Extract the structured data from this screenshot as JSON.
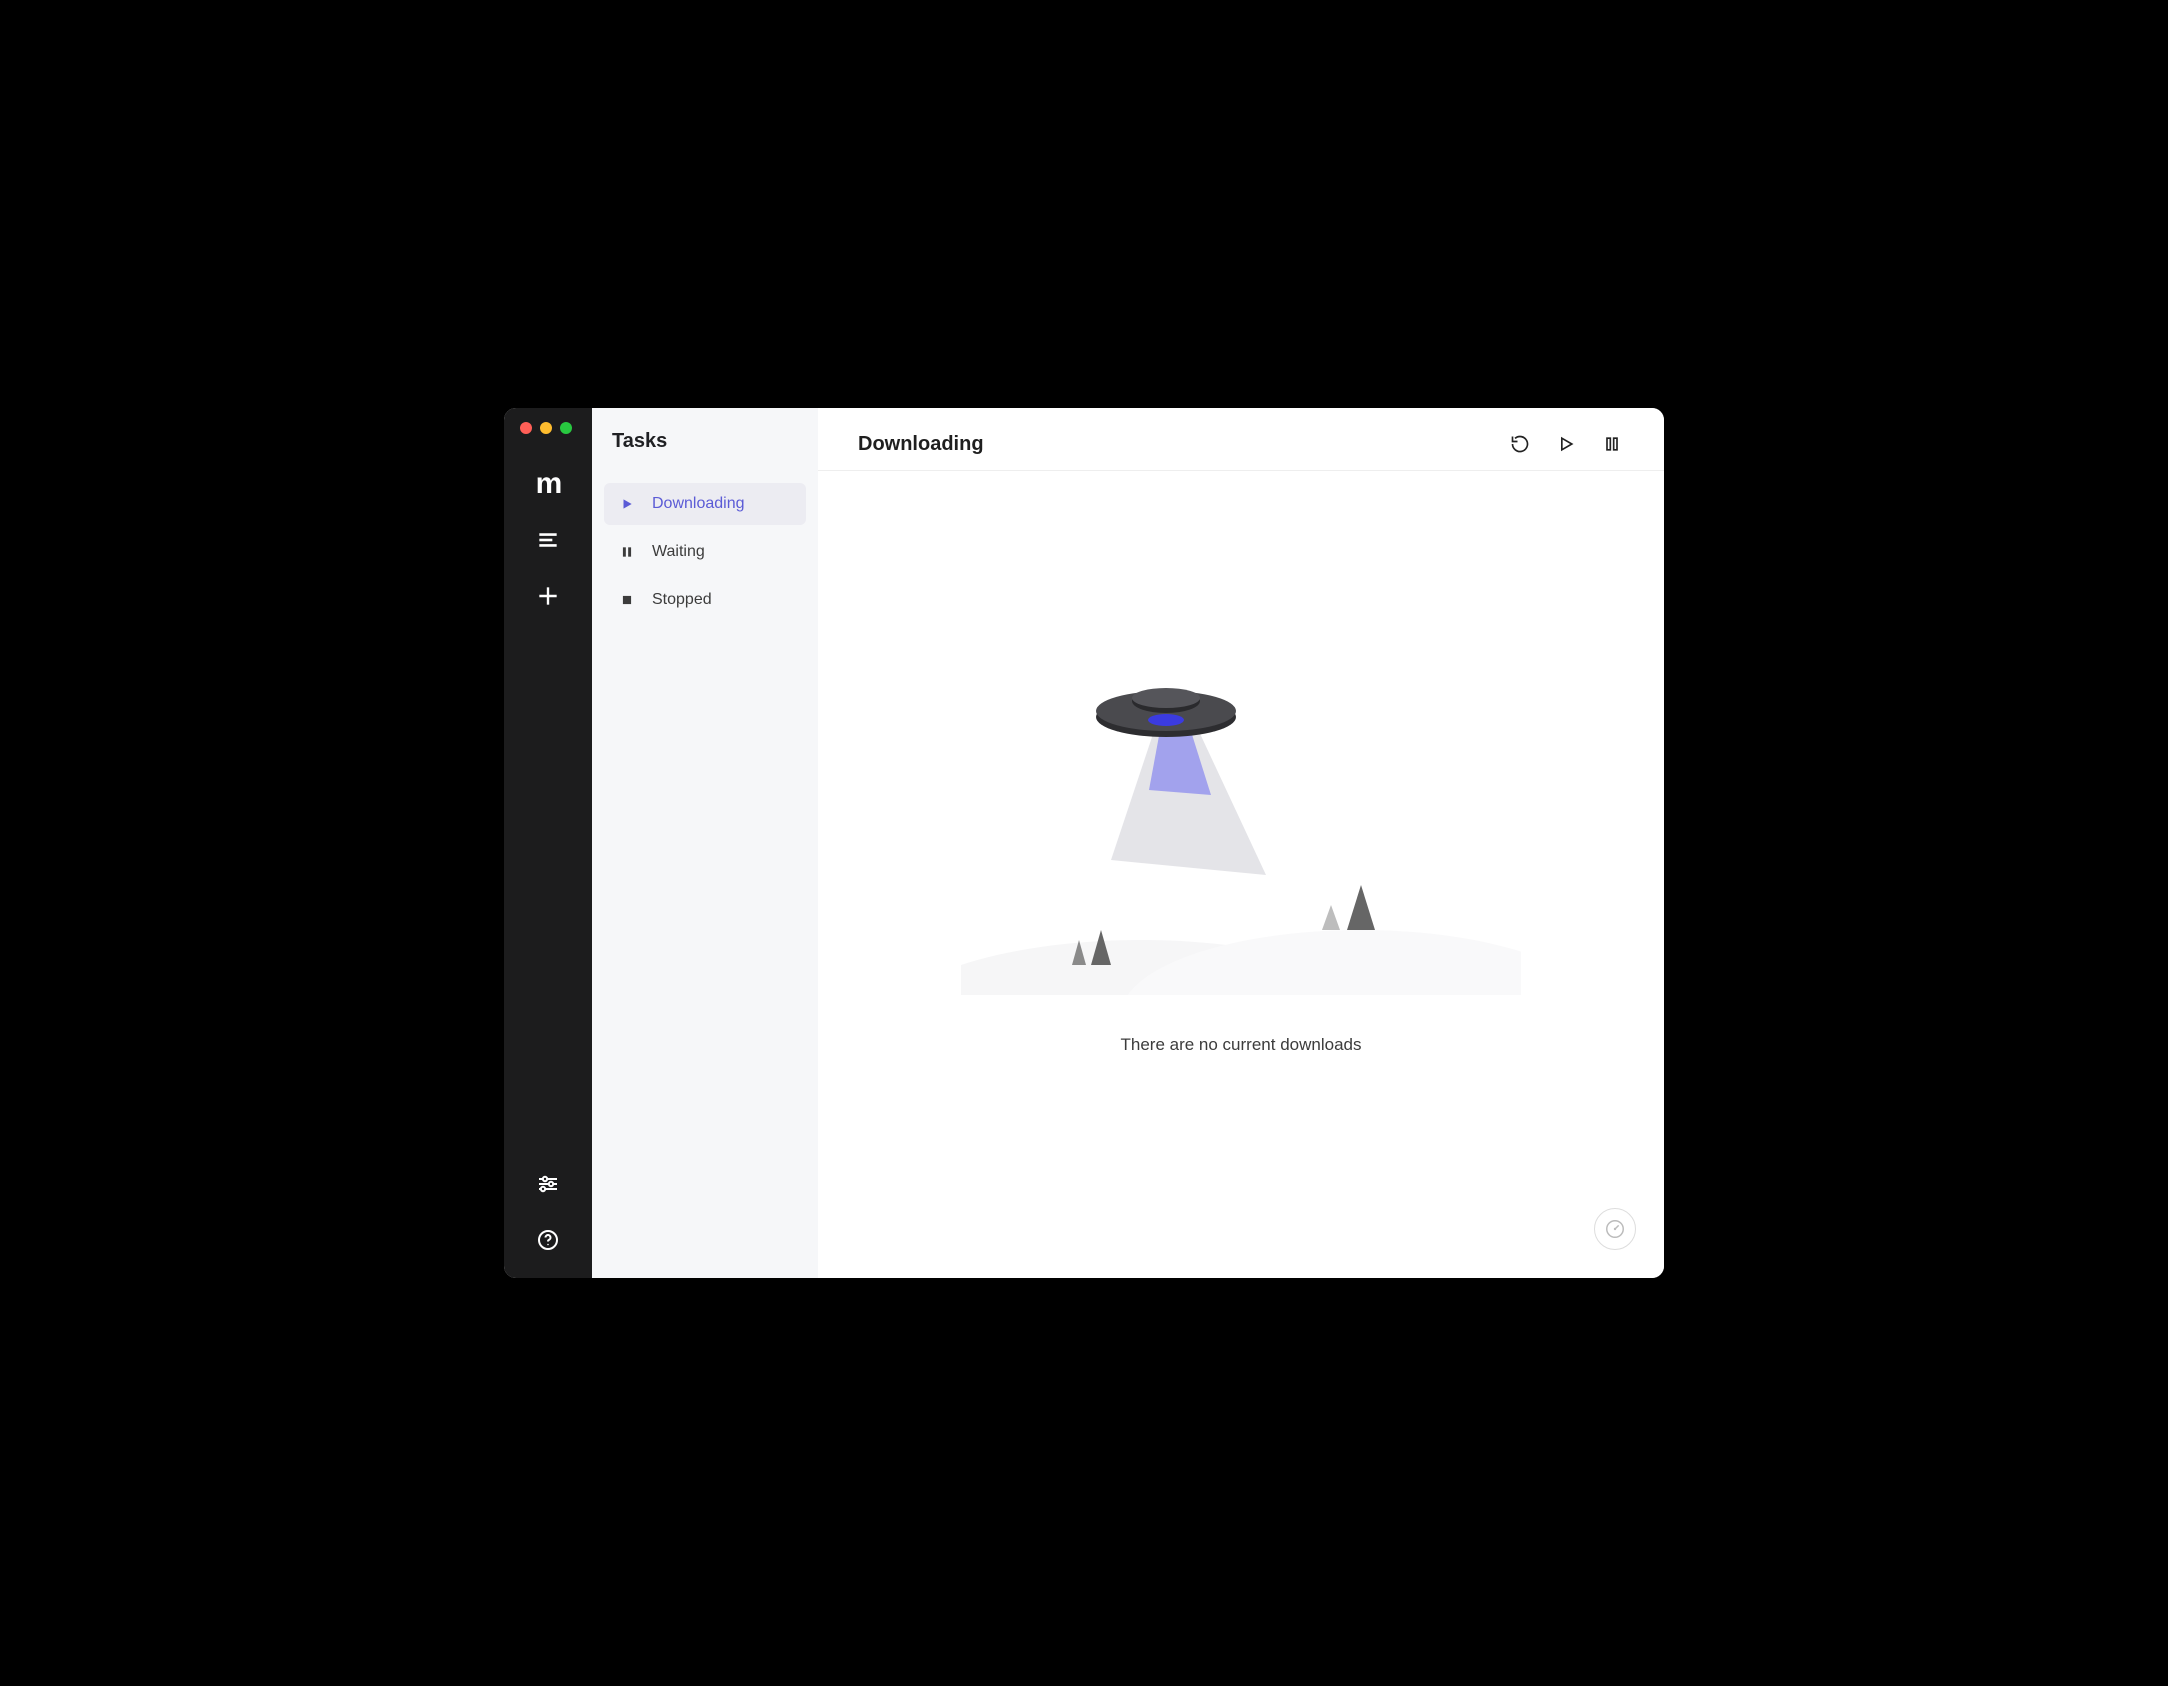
{
  "colors": {
    "accent": "#5b5bd6",
    "rail_bg": "#1c1c1d",
    "sidebar_bg": "#f6f7f9"
  },
  "window": {
    "traffic_lights": [
      "close",
      "minimize",
      "maximize"
    ]
  },
  "rail": {
    "logo": "m",
    "items": [
      {
        "name": "tasks",
        "icon": "list-icon"
      },
      {
        "name": "add",
        "icon": "plus-icon"
      }
    ],
    "footer": [
      {
        "name": "settings",
        "icon": "sliders-icon"
      },
      {
        "name": "help",
        "icon": "help-icon"
      }
    ]
  },
  "sidebar": {
    "title": "Tasks",
    "items": [
      {
        "label": "Downloading",
        "icon": "play-icon",
        "active": true
      },
      {
        "label": "Waiting",
        "icon": "pause-icon",
        "active": false
      },
      {
        "label": "Stopped",
        "icon": "stop-icon",
        "active": false
      }
    ]
  },
  "main": {
    "title": "Downloading",
    "toolbar": [
      {
        "name": "refresh",
        "icon": "refresh-icon"
      },
      {
        "name": "resume-all",
        "icon": "play-outline-icon"
      },
      {
        "name": "pause-all",
        "icon": "pause-outline-icon"
      }
    ],
    "empty_state": {
      "message": "There are no current downloads",
      "illustration": "ufo-empty"
    }
  },
  "status": {
    "speed_indicator": "speedometer-icon"
  }
}
